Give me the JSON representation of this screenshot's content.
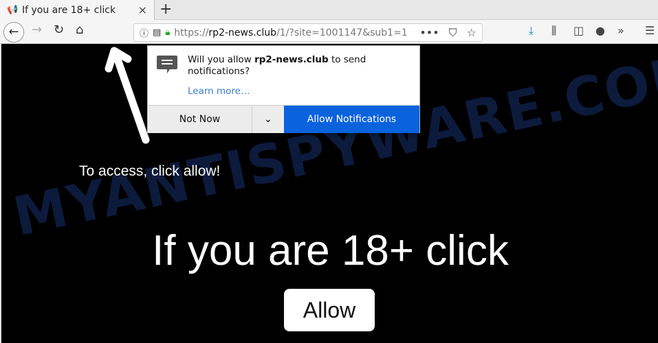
{
  "tab": {
    "title": "If you are 18+ click",
    "close": "×",
    "new_tab": "+"
  },
  "nav": {
    "url_scheme": "https://",
    "url_host": "rp2-news.club",
    "url_path": "/1/?site=1001147&sub1=1"
  },
  "popup": {
    "msg_pre": "Will you allow ",
    "msg_host": "rp2-news.club",
    "msg_post": " to send notifications?",
    "learn_more": "Learn more…",
    "not_now": "Not Now",
    "allow": "Allow Notifications"
  },
  "page": {
    "access_text": "To access, click allow!",
    "headline": "If you are 18+ click",
    "allow_button": "Allow",
    "watermark": "MYANTISPYWARE.COM"
  },
  "colors": {
    "accent": "#0a62dd",
    "download": "#1a73e8"
  }
}
